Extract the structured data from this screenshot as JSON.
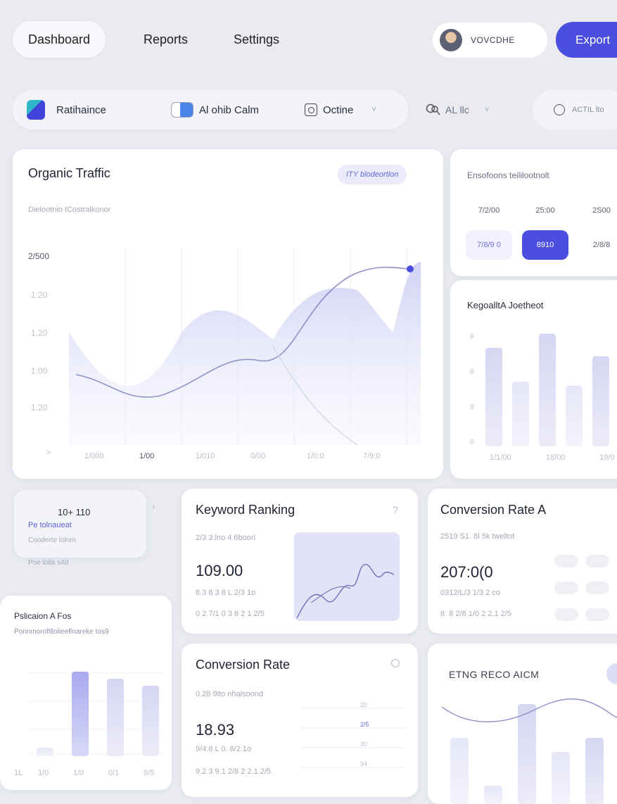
{
  "nav": {
    "tabs": [
      "Dashboard",
      "Reports",
      "Settings"
    ],
    "user_name": "VOVCDHE",
    "export_label": "Export"
  },
  "filters": {
    "brand": "Ratihaince",
    "ai": "Al ohib Calm",
    "option": "Octine",
    "all": "AL llc",
    "search_placeholder": "ACTIL lto"
  },
  "traffic": {
    "title": "Organic Traffic",
    "badge": "ITY blodeortlon",
    "subtitle": "Dielootnio tCostralkonor",
    "y_labels": [
      "2/500",
      "1:20",
      "1.20",
      "1:00",
      "1.20"
    ],
    "x_labels": [
      "1/000",
      "1/00",
      "1/010",
      "0/00",
      "1/0:0",
      "7/9:0"
    ],
    "marker": ">"
  },
  "top_right": {
    "title": "Ensofoons teililootnolt",
    "row1": [
      "7/2/00",
      "25:00",
      "2S00"
    ],
    "row2": [
      "7/8/9 0",
      "8910",
      "2/8/8"
    ]
  },
  "keyword_bars": {
    "title": "KegoalltA Joetheot",
    "y_labels": [
      "8",
      "8",
      "8",
      "0"
    ],
    "x_labels": [
      "1/1/00",
      "18/00",
      "19/0"
    ]
  },
  "mini_card": {
    "value": "10+ 110",
    "link": "Pe tolnaueat",
    "line1": "Cooderte lolnm",
    "line2": "Poe lolla s4d"
  },
  "pub": {
    "title": "Pslicaion A Fos",
    "subtitle": "Ponnmoroftllolieeflnareke tos9",
    "x_labels": [
      "1L",
      "1/0",
      "1/0",
      "0/1",
      "9/5"
    ]
  },
  "keyword": {
    "title": "Keyword Ranking",
    "sub": "2/3 3:lno 4 6boorl",
    "value": "109.00",
    "line1": "8.3 8 3 8 L 2/3 1o",
    "line2": "0 2 7/1 0 3 8 2 1 2/5"
  },
  "conversion_a": {
    "title": "Conversion Rate A",
    "sub": "2519 S1. 8l 5k tweltot",
    "value": "207:0(0",
    "line1": "0312/L/3 1/3 2 co",
    "line2": "8: 8 2/8 1/0 2 2.1 2/5"
  },
  "conversion": {
    "title": "Conversion Rate",
    "sub": "0.28 9lto nhalsoond",
    "value": "18.93",
    "line1": "9/4:8 L 0. 8/2 1o",
    "line2": "9.2 3 9 1 2/8 2 2.1 2/5",
    "scale": [
      "20",
      "2/5",
      "30",
      "94"
    ]
  },
  "recommend": {
    "title": "ETNG RECO AICM"
  },
  "colors": {
    "accent": "#4a4fe0",
    "background": "#e9ebf1",
    "card": "#ffffff"
  }
}
